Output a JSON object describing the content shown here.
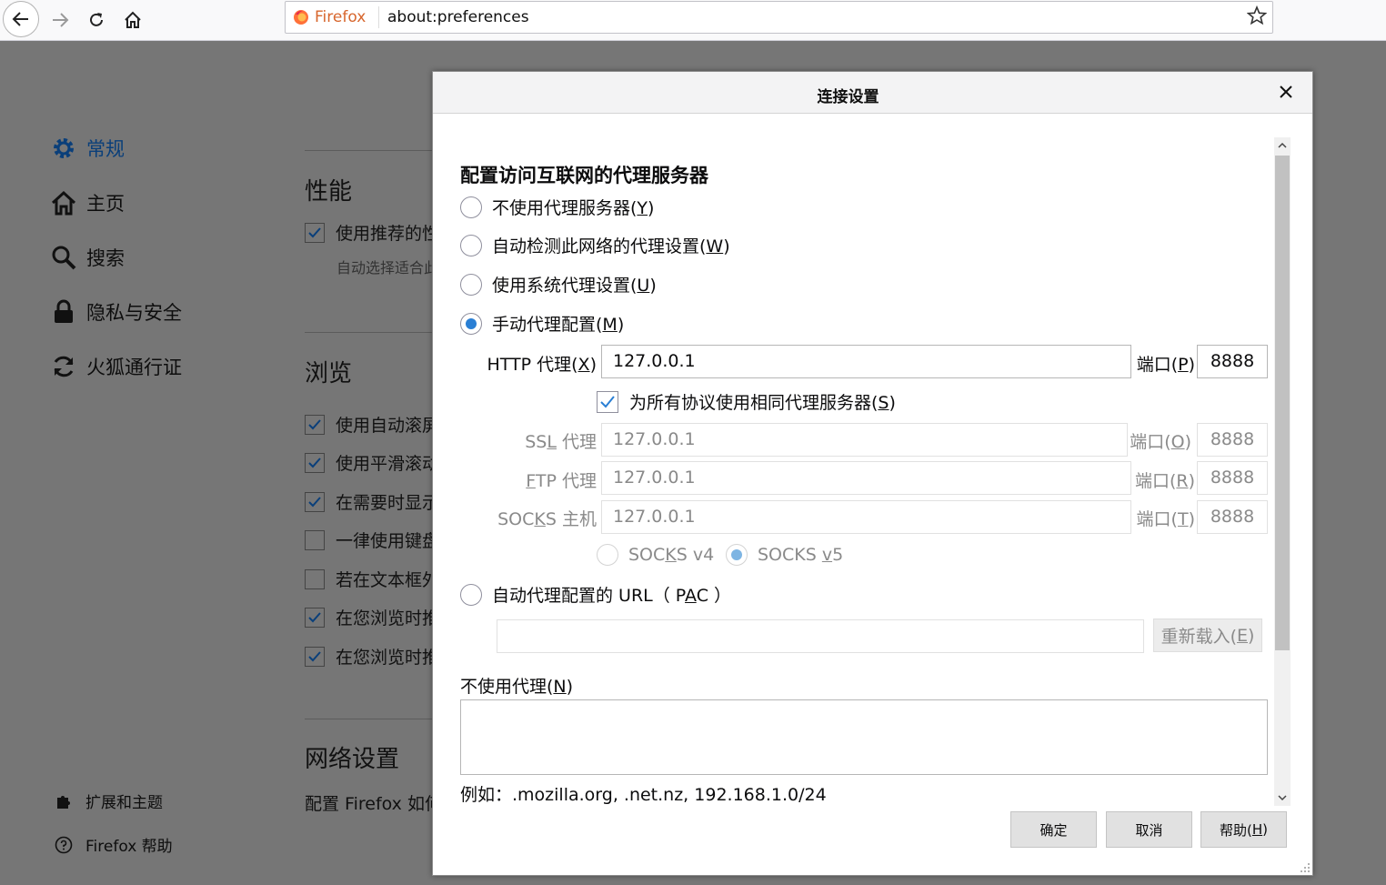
{
  "browser": {
    "identity_label": "Firefox",
    "url": "about:preferences"
  },
  "sidebar": {
    "items": [
      {
        "label": "常规",
        "icon": "gear-icon"
      },
      {
        "label": "主页",
        "icon": "home-icon"
      },
      {
        "label": "搜索",
        "icon": "search-icon"
      },
      {
        "label": "隐私与安全",
        "icon": "lock-icon"
      },
      {
        "label": "火狐通行证",
        "icon": "sync-icon"
      }
    ],
    "footer": [
      {
        "label": "扩展和主题",
        "icon": "puzzle-icon"
      },
      {
        "label": "Firefox 帮助",
        "icon": "help-icon"
      }
    ]
  },
  "prefs": {
    "performance_heading": "性能",
    "performance_check": "使用推荐的性",
    "performance_sub": "自动选择适合此",
    "browsing_heading": "浏览",
    "browsing_checks": [
      {
        "label": "使用自动滚屏",
        "checked": true
      },
      {
        "label": "使用平滑滚动",
        "checked": true
      },
      {
        "label": "在需要时显示",
        "checked": true
      },
      {
        "label": "一律使用键盘",
        "checked": false
      },
      {
        "label": "若在文本框外",
        "checked": false
      },
      {
        "label": "在您浏览时推",
        "checked": true
      },
      {
        "label": "在您浏览时推",
        "checked": true
      }
    ],
    "network_heading": "网络设置",
    "network_text": "配置 Firefox 如何"
  },
  "dialog": {
    "title": "连接设置",
    "heading": "配置访问互联网的代理服务器",
    "options": {
      "no_proxy": {
        "text": "不使用代理服务器(",
        "key": "Y",
        "end": ")"
      },
      "auto_detect": {
        "text": "自动检测此网络的代理设置(",
        "key": "W",
        "end": ")"
      },
      "system": {
        "text": "使用系统代理设置(",
        "key": "U",
        "end": ")"
      },
      "manual": {
        "text": "手动代理配置(",
        "key": "M",
        "end": ")"
      },
      "pac": {
        "text_a": "自动代理配置的 URL（ P",
        "key": "A",
        "text_b": "C ）"
      }
    },
    "selected_option": "manual",
    "http": {
      "label_a": "HTTP 代理(",
      "key": "X",
      "label_b": ")",
      "value": "127.0.0.1",
      "port_label_a": "端口(",
      "port_key": "P",
      "port_label_b": ")",
      "port": "8888"
    },
    "same_proxy": {
      "text_a": "为所有协议使用相同代理服务器(",
      "key": "S",
      "text_b": ")",
      "checked": true
    },
    "ssl": {
      "label_a": "SS",
      "key": "L",
      "label_b": " 代理",
      "value": "127.0.0.1",
      "port_label_a": "端口(",
      "port_key": "O",
      "port_label_b": ")",
      "port": "8888"
    },
    "ftp": {
      "label_a": "",
      "key": "F",
      "label_b": "TP 代理",
      "value": "127.0.0.1",
      "port_label_a": "端口(",
      "port_key": "R",
      "port_label_b": ")",
      "port": "8888"
    },
    "socks": {
      "label_a": "SOC",
      "key": "K",
      "label_b": "S 主机",
      "value": "127.0.0.1",
      "port_label_a": "端口(",
      "port_key": "T",
      "port_label_b": ")",
      "port": "8888"
    },
    "socks_v4": {
      "text_a": "SOC",
      "key": "K",
      "text_b": "S v4"
    },
    "socks_v5": {
      "text_a": "SOCKS ",
      "key": "v",
      "text_b": "5",
      "selected": true
    },
    "pac_url": "",
    "reload": {
      "text_a": "重新载入(",
      "key": "E",
      "text_b": ")"
    },
    "no_proxy_for": {
      "text_a": "不使用代理(",
      "key": "N",
      "text_b": ")",
      "value": ""
    },
    "example": "例如：.mozilla.org, .net.nz, 192.168.1.0/24",
    "buttons": {
      "ok": "确定",
      "cancel": "取消",
      "help_a": "帮助(",
      "help_key": "H",
      "help_b": ")"
    }
  },
  "colors": {
    "accent": "#2a7fd4",
    "firefox_orange": "#d7662d",
    "sidebar_selected": "#0a3f7a",
    "overlay": "#767676"
  }
}
